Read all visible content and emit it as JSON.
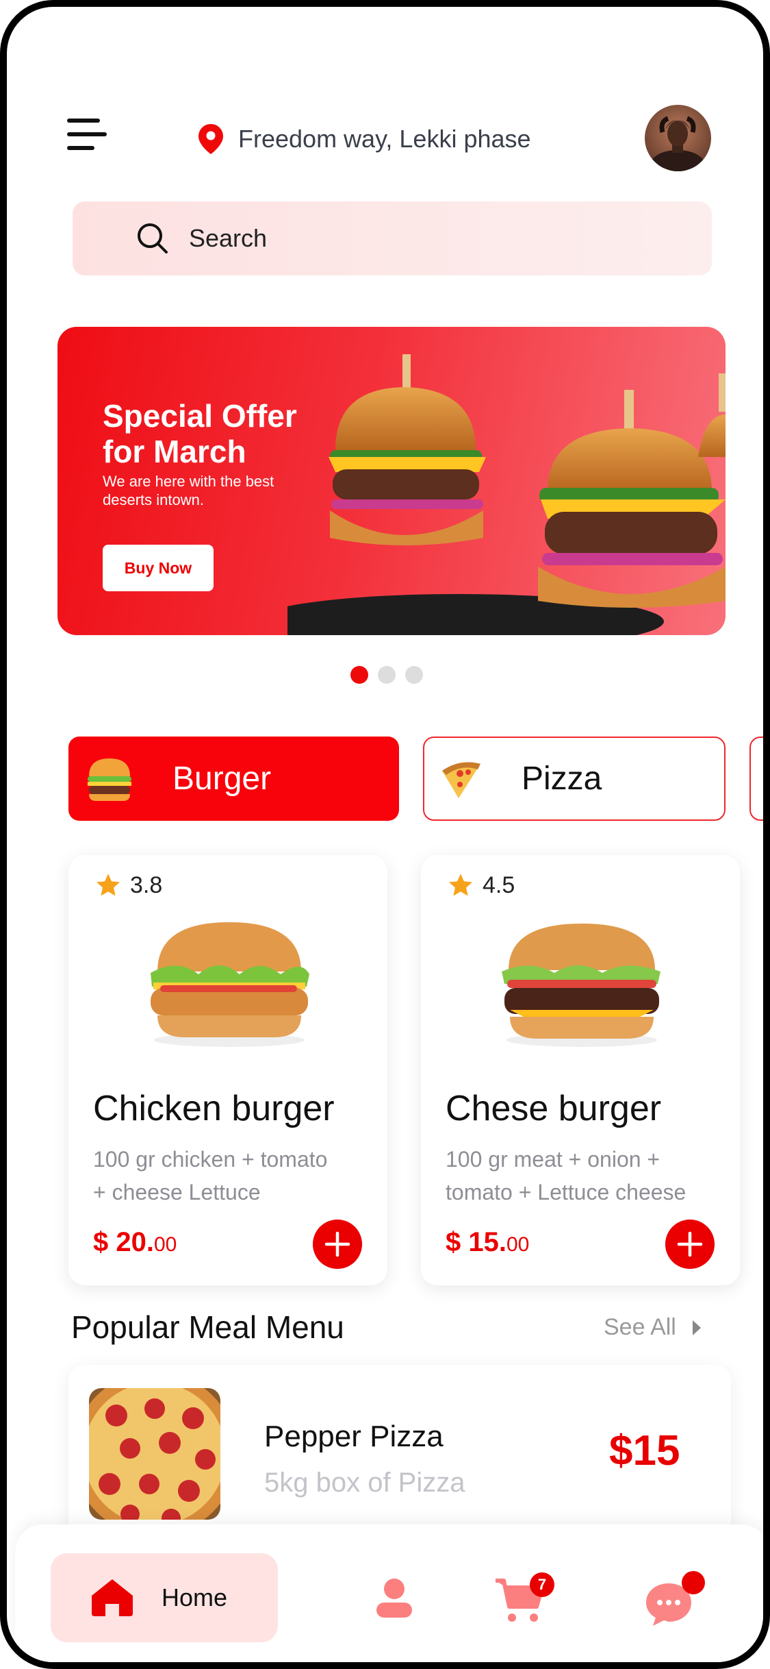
{
  "header": {
    "location": "Freedom way, Lekki phase",
    "location_icon": "location-pin-icon",
    "menu_icon": "hamburger-menu-icon"
  },
  "search": {
    "placeholder": "Search"
  },
  "banner": {
    "title_line1": "Special Offer",
    "title_line2": "for March",
    "subtitle_line1": "We are here with the best",
    "subtitle_line2": "deserts intown.",
    "button_label": "Buy Now",
    "carousel_active_index": 0,
    "carousel_count": 3
  },
  "categories": [
    {
      "label": "Burger",
      "icon": "burger-icon",
      "active": true
    },
    {
      "label": "Pizza",
      "icon": "pizza-slice-icon",
      "active": false
    }
  ],
  "foods": [
    {
      "rating": "3.8",
      "name": "Chicken burger",
      "desc_line1": "100 gr chicken + tomato",
      "desc_line2": "+ cheese  Lettuce",
      "price_main": "$ 20.",
      "price_cents": "00"
    },
    {
      "rating": "4.5",
      "name": "Chese burger",
      "desc_line1": "100 gr meat + onion +",
      "desc_line2": "tomato + Lettuce cheese",
      "price_main": "$ 15.",
      "price_cents": "00"
    }
  ],
  "popular": {
    "title": "Popular Meal Menu",
    "see_all": "See All",
    "items": [
      {
        "name": "Pepper Pizza",
        "subtitle": "5kg box of Pizza",
        "price": "$15"
      }
    ]
  },
  "nav": {
    "home_label": "Home",
    "cart_count": "7",
    "colors": {
      "accent": "#ea0000",
      "accent_soft": "#ffe3e3"
    }
  }
}
